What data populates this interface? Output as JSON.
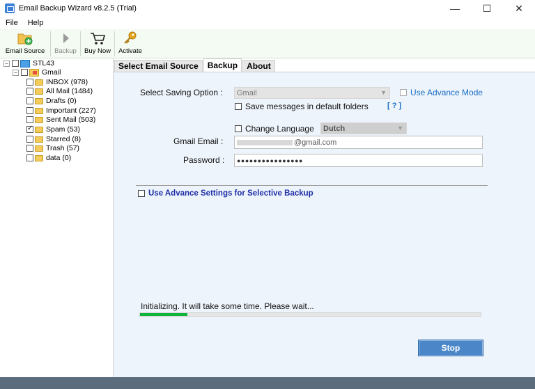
{
  "window": {
    "title": "Email Backup Wizard v8.2.5 (Trial)",
    "minimize": "—",
    "maximize": "☐",
    "close": "✕"
  },
  "menu": [
    "File",
    "Help"
  ],
  "toolbar": {
    "email_source": "Email Source",
    "backup": "Backup",
    "buy_now": "Buy Now",
    "activate": "Activate"
  },
  "tree": {
    "root": "STL43",
    "account": "Gmail",
    "folders": [
      {
        "label": "INBOX (978)",
        "checked": false
      },
      {
        "label": "All Mail (1484)",
        "checked": false
      },
      {
        "label": "Drafts (0)",
        "checked": false
      },
      {
        "label": "Important (227)",
        "checked": false
      },
      {
        "label": "Sent Mail (503)",
        "checked": false
      },
      {
        "label": "Spam (53)",
        "checked": true
      },
      {
        "label": "Starred (8)",
        "checked": false
      },
      {
        "label": "Trash (57)",
        "checked": false
      },
      {
        "label": "data (0)",
        "checked": false
      }
    ]
  },
  "tabs": [
    "Select Email Source",
    "Backup",
    "About"
  ],
  "backup": {
    "saving_option_label": "Select Saving Option :",
    "saving_option_value": "Gmail",
    "advance_mode_label": "Use Advance Mode",
    "default_folders_label": "Save messages in default folders",
    "help_link": "[ ? ]",
    "change_language_label": "Change Language",
    "language_value": "Dutch",
    "gmail_email_label": "Gmail Email :",
    "gmail_email_value": "@gmail.com",
    "password_label": "Password :",
    "password_value": "●●●●●●●●●●●●●●●●",
    "advance_settings_label": "Use Advance Settings for Selective Backup",
    "status_text": "Initializing. It will take some time. Please wait...",
    "progress_fraction": 0.14,
    "stop_label": "Stop"
  },
  "colors": {
    "accent": "#1a6fc4",
    "progress": "#12b43c",
    "stop_button": "#4a86c8"
  }
}
